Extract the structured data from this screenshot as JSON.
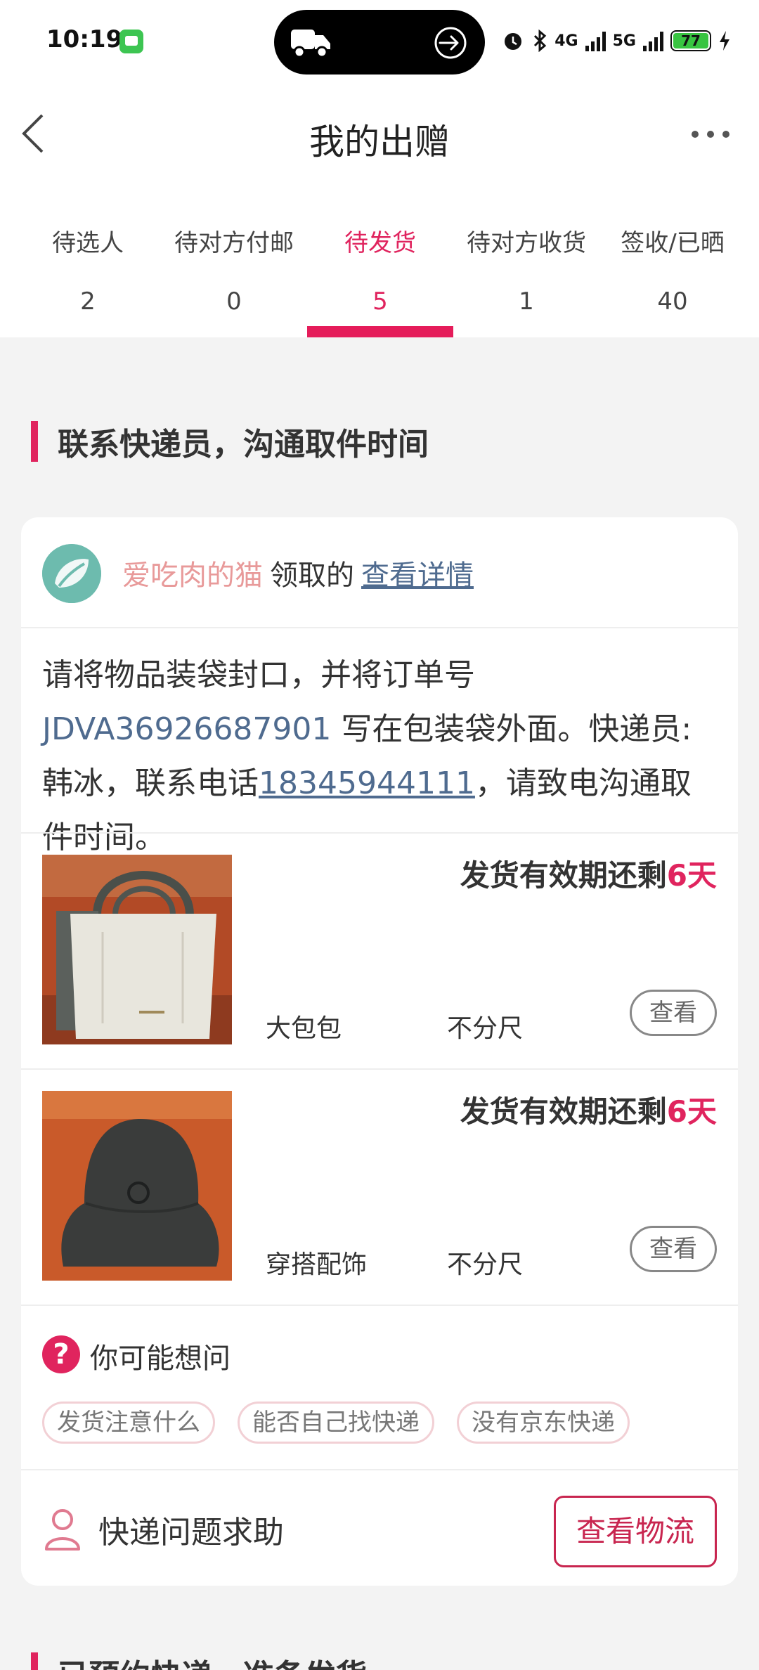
{
  "status_bar": {
    "time": "10:19",
    "network_1": "4G",
    "network_2": "5G",
    "battery": "77"
  },
  "header": {
    "title": "我的出赠"
  },
  "tabs": [
    {
      "label": "待选人",
      "count": "2",
      "active": false
    },
    {
      "label": "待对方付邮",
      "count": "0",
      "active": false
    },
    {
      "label": "待发货",
      "count": "5",
      "active": true
    },
    {
      "label": "待对方收货",
      "count": "1",
      "active": false
    },
    {
      "label": "签收/已晒",
      "count": "40",
      "active": false
    }
  ],
  "section": {
    "title": "联系快递员，沟通取件时间",
    "next_title": "已预约快递，准备发货"
  },
  "card": {
    "receiver_name": "爱吃肉的猫",
    "receiver_mid": "领取的",
    "detail_link": "查看详情",
    "instruction": {
      "part1": "请将物品装袋封口，并将订单号 ",
      "order_no": "JDVA36926687901",
      "part2": " 写在包装袋外面。快递员:韩冰，联系电话",
      "phone": "18345944111",
      "part3": "，请致电沟通取件时间。"
    },
    "items": [
      {
        "deadline_prefix": "发货有效期还剩",
        "days": "6天",
        "category": "大包包",
        "size": "不分尺",
        "button": "查看"
      },
      {
        "deadline_prefix": "发货有效期还剩",
        "days": "6天",
        "category": "穿搭配饰",
        "size": "不分尺",
        "button": "查看"
      }
    ],
    "faq": {
      "title": "你可能想问",
      "chips": [
        "发货注意什么",
        "能否自己找快递",
        "没有京东快递"
      ]
    },
    "help": {
      "label": "快递问题求助",
      "button": "查看物流"
    }
  },
  "colors": {
    "accent": "#e0245e",
    "link": "#4f6b8f",
    "receiver_name": "#e89a9a"
  }
}
